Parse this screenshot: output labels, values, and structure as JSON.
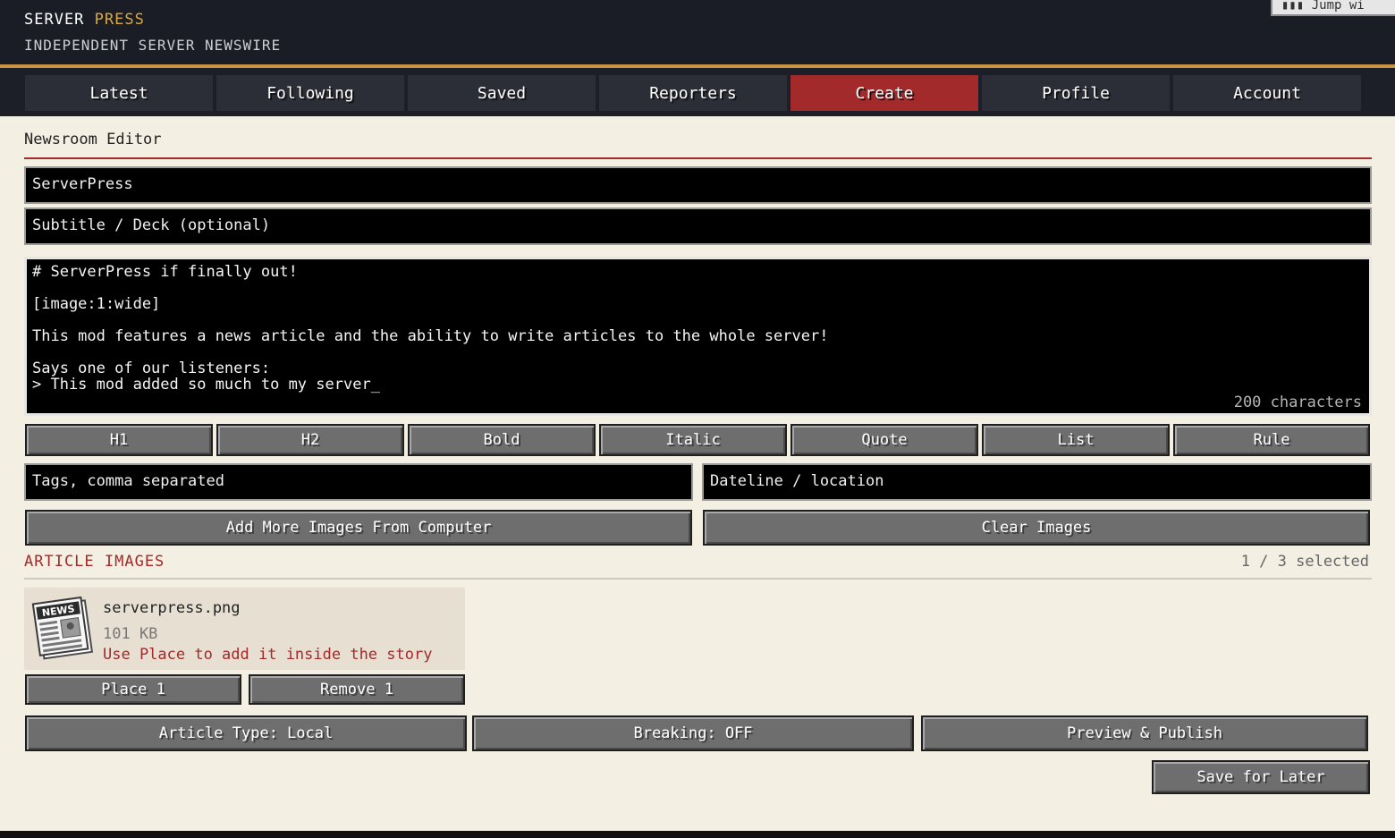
{
  "header": {
    "brand_part1": "SERVER",
    "brand_part2": "PRESS",
    "tagline": "INDEPENDENT SERVER NEWSWIRE",
    "jump_button": "Jump wi"
  },
  "nav": {
    "tabs": [
      "Latest",
      "Following",
      "Saved",
      "Reporters",
      "Create",
      "Profile",
      "Account"
    ],
    "active": "Create"
  },
  "editor": {
    "section_title": "Newsroom Editor",
    "headline_value": "ServerPress",
    "subtitle_placeholder": "Subtitle / Deck (optional)",
    "body_lines": [
      "# ServerPress if finally out!",
      "[image:1:wide]",
      "This mod features a news article and the ability to write articles to the whole server!",
      "Says one of our listeners:",
      "> This mod added so much to my server_"
    ],
    "char_count": "200 characters"
  },
  "format_buttons": [
    "H1",
    "H2",
    "Bold",
    "Italic",
    "Quote",
    "List",
    "Rule"
  ],
  "tags_placeholder": "Tags, comma separated",
  "dateline_placeholder": "Dateline / location",
  "image_actions": {
    "add": "Add More Images From Computer",
    "clear": "Clear Images"
  },
  "images_section": {
    "label": "ARTICLE IMAGES",
    "selected": "1 / 3 selected",
    "items": [
      {
        "filename": "serverpress.png",
        "size": "101 KB",
        "hint": "Use Place to add it inside the story",
        "thumb_text": "NEWS",
        "place_label": "Place 1",
        "remove_label": "Remove 1"
      }
    ]
  },
  "actions": {
    "article_type": "Article Type: Local",
    "breaking": "Breaking: OFF",
    "preview": "Preview & Publish",
    "save_later": "Save for Later"
  },
  "colors": {
    "accent_red": "#a32a2a",
    "accent_gold": "#c5963f",
    "header_bg": "#1a1d25",
    "page_bg": "#f3efe3"
  }
}
